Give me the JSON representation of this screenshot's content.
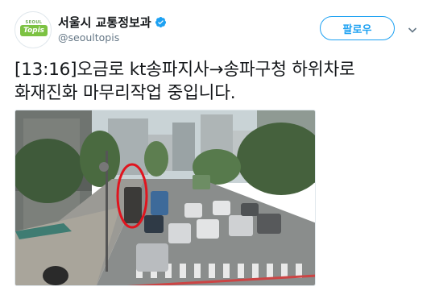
{
  "account": {
    "display_name": "서울시 교통정보과",
    "handle": "@seoultopis",
    "verified": true,
    "avatar_logo_small": "SEOUL",
    "avatar_logo_main": "Topis",
    "avatar_icon": "topis-logo"
  },
  "actions": {
    "follow_label": "팔로우",
    "more_icon": "chevron-down-icon"
  },
  "tweet": {
    "text": "[13:16]오금로 kt송파지사→송파구청 하위차로\n화재진화 마무리작업 중입니다."
  },
  "media": {
    "type": "photo",
    "subject": "traffic camera street view with red circle highlighting a vehicle"
  },
  "colors": {
    "accent": "#1da1f2",
    "text": "#14171a",
    "secondary": "#657786",
    "highlight_circle": "#e0141e"
  }
}
